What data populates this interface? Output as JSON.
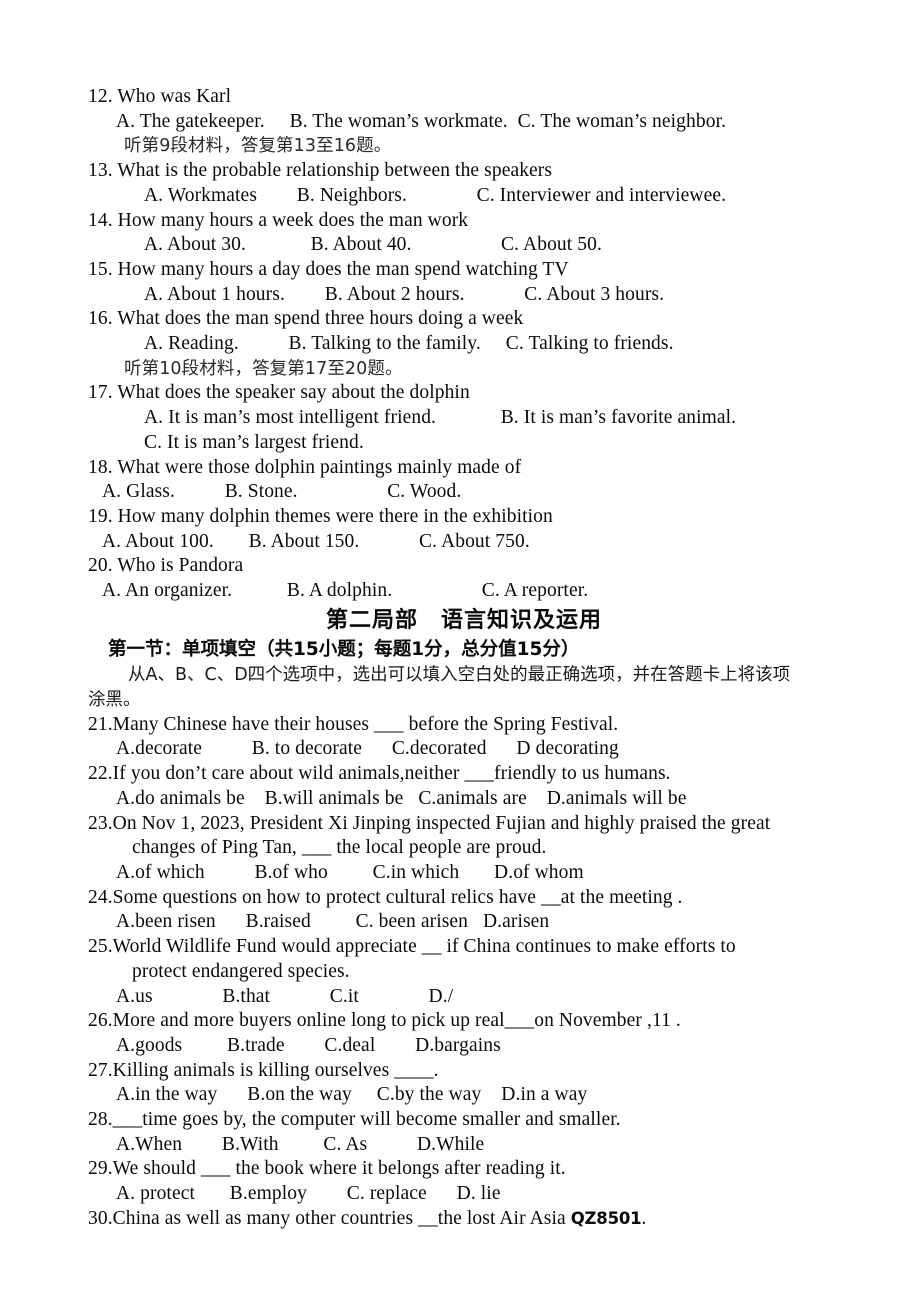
{
  "page": {
    "background_color": "#ffffff",
    "text_color": "#0a0a0a"
  },
  "listening_section": {
    "questions": [
      {
        "number": "12.",
        "stem": "12. Who was Karl",
        "options_line": "A. The gatekeeper.     B. The woman’s workmate.  C. The woman’s neighbor."
      },
      {
        "number": "13.",
        "stem": "13. What is the probable relationship between the speakers",
        "options_line": "A. Workmates        B. Neighbors.              C. Interviewer and interviewee."
      },
      {
        "number": "14.",
        "stem": "14. How many hours a week does the man work",
        "options_line": "A. About 30.             B. About 40.                  C. About 50."
      },
      {
        "number": "15.",
        "stem": "15. How many hours a day does the man spend watching TV",
        "options_line": "A. About 1 hours.        B. About 2 hours.            C. About 3 hours."
      },
      {
        "number": "16.",
        "stem": "16. What does the man spend three hours doing a week",
        "options_line": "A. Reading.          B. Talking to the family.     C. Talking to friends."
      },
      {
        "number": "17.",
        "stem": "17. What does the speaker say about the dolphin",
        "options_line": "A. It is man’s most intelligent friend.             B. It is man’s favorite animal.",
        "options_line_2": "C. It is man’s largest friend."
      },
      {
        "number": "18.",
        "stem": "18. What were those dolphin paintings mainly made of",
        "options_line": "A. Glass.          B. Stone.                  C. Wood."
      },
      {
        "number": "19.",
        "stem": "19. How many dolphin themes were there in the exhibition",
        "options_line": "A. About 100.       B. About 150.            C. About 750."
      },
      {
        "number": "20.",
        "stem": "20. Who is Pandora",
        "options_line": "A. An organizer.           B. A dolphin.                  C. A reporter."
      }
    ],
    "audio_cue_9": "听第9段材料，答复第13至16题。",
    "audio_cue_10": "听第10段材料，答复第17至20题。"
  },
  "part_two": {
    "title": "第二局部　语言知识及运用",
    "subsection_title": "第一节：单项填空（共15小题；每题1分，总分值15分）",
    "instruction_line_1": "从A、B、C、D四个选项中，选出可以填入空白处的最正确选项，并在答题卡上将该项",
    "instruction_line_2": "涂黑。",
    "questions": [
      {
        "stem": "21.Many Chinese have their houses ___ before the Spring Festival.",
        "options_line": "A.decorate          B. to decorate      C.decorated      D decorating"
      },
      {
        "stem": "22.If you don’t care about wild animals,neither ___friendly to us humans.",
        "options_line": "A.do animals be    B.will animals be   C.animals are    D.animals will be"
      },
      {
        "stem": "23.On Nov 1, 2023, President Xi Jinping inspected Fujian and highly praised the great",
        "stem_cont": "changes of Ping Tan, ___ the local people are proud.",
        "options_line": "A.of which          B.of who         C.in which       D.of whom"
      },
      {
        "stem": "24.Some questions on how to protect cultural relics have __at the meeting .",
        "options_line": "A.been risen      B.raised         C. been arisen   D.arisen"
      },
      {
        "stem": "25.World Wildlife Fund would appreciate __ if China continues to make efforts to",
        "stem_cont": "protect endangered species.",
        "options_line": "A.us              B.that            C.it              D./"
      },
      {
        "stem": "26.More and more buyers online long to pick up real___on November ,11 .",
        "options_line": "A.goods         B.trade        C.deal        D.bargains"
      },
      {
        "stem": "27.Killing animals is killing ourselves ____.",
        "options_line": "A.in the way      B.on the way     C.by the way    D.in a way"
      },
      {
        "stem": "28.___time goes by, the computer will become smaller and smaller.",
        "options_line": "A.When        B.With         C. As          D.While"
      },
      {
        "stem": "29.We should ___ the book where it belongs after reading it.",
        "options_line": "A. protect       B.employ        C. replace      D. lie"
      },
      {
        "stem_prefix": "30.China as well as many other countries __the lost Air Asia ",
        "stem_code": "QZ8501",
        "stem_suffix": "."
      }
    ]
  }
}
